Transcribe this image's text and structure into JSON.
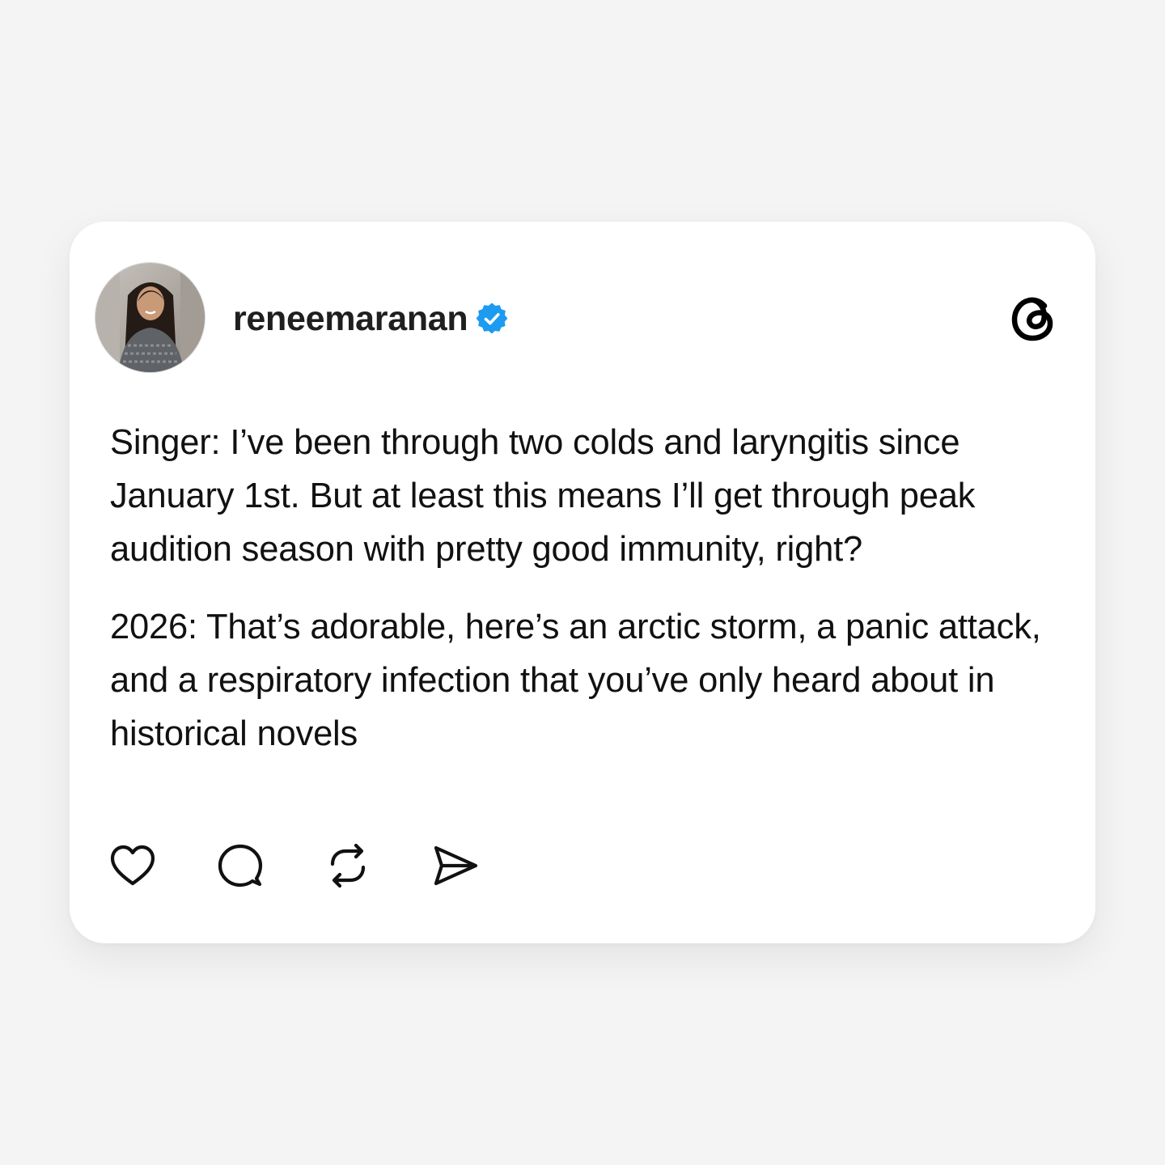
{
  "post": {
    "username": "reneemaranan",
    "verified_icon": "verified-badge-icon",
    "avatar": "profile-photo",
    "platform_logo": "threads-logo-icon",
    "paragraphs": [
      "Singer: I’ve been through two colds and laryngitis since January 1st. But at least this means I’ll get through peak audition season with pretty good immunity, right?",
      "2026: That’s adorable, here’s an arctic storm, a panic attack, and a respiratory infection that you’ve only heard about in historical novels"
    ]
  },
  "actions": [
    {
      "icon": "heart-icon"
    },
    {
      "icon": "comment-icon"
    },
    {
      "icon": "repost-icon"
    },
    {
      "icon": "share-icon"
    }
  ],
  "colors": {
    "background": "#f4f4f4",
    "card": "#ffffff",
    "text": "#111111",
    "verified": "#1d9bf0"
  }
}
